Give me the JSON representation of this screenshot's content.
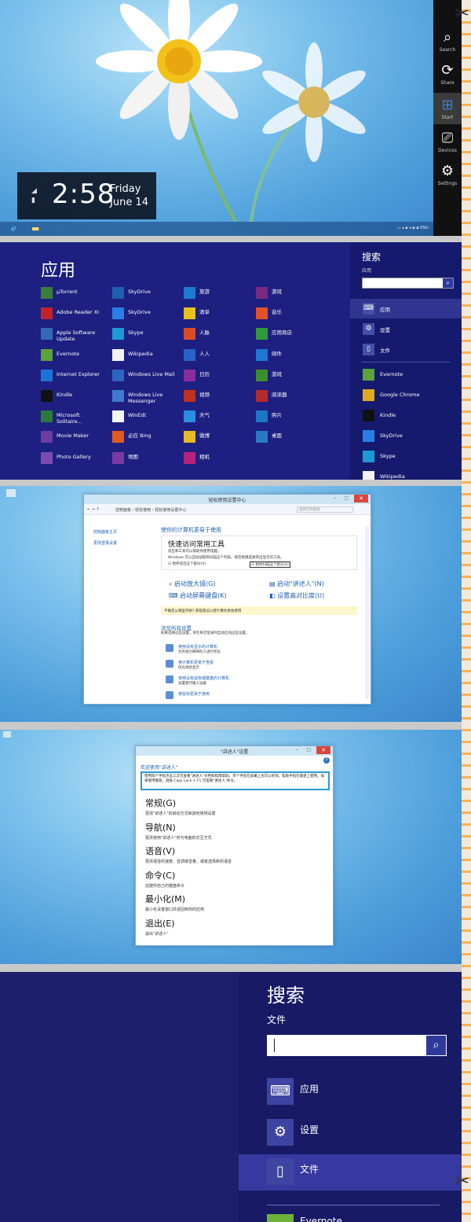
{
  "panel1": {
    "charms": [
      {
        "label": "Search",
        "icon": "search-icon"
      },
      {
        "label": "Share",
        "icon": "share-icon"
      },
      {
        "label": "Start",
        "icon": "windows-icon"
      },
      {
        "label": "Devices",
        "icon": "devices-icon"
      },
      {
        "label": "Settings",
        "icon": "gear-icon"
      }
    ],
    "clock": {
      "time": "2:58",
      "day": "Friday",
      "date": "June 14"
    },
    "tray_text": "ENG"
  },
  "panel2": {
    "title": "应用",
    "apps": [
      {
        "name": "µTorrent",
        "color": "#3a7f3a"
      },
      {
        "name": "SkyDrive",
        "color": "#1f5fb0"
      },
      {
        "name": "旅游",
        "color": "#1d7ad1"
      },
      {
        "name": "游戏",
        "color": "#7a2a82"
      },
      {
        "name": "Adobe Reader XI",
        "color": "#c8202a"
      },
      {
        "name": "SkyDrive",
        "color": "#2a7ee6"
      },
      {
        "name": "清单",
        "color": "#e8c21a"
      },
      {
        "name": "音乐",
        "color": "#e4502a"
      },
      {
        "name": "Apple Software Update",
        "color": "#3569b8"
      },
      {
        "name": "Skype",
        "color": "#1b9ad7"
      },
      {
        "name": "人脉",
        "color": "#d94c28"
      },
      {
        "name": "应用商店",
        "color": "#2f9a3c"
      },
      {
        "name": "Evernote",
        "color": "#5ca33a"
      },
      {
        "name": "Wikipedia",
        "color": "#f2f2f2"
      },
      {
        "name": "人人",
        "color": "#2a62c9"
      },
      {
        "name": "邮件",
        "color": "#1f77d1"
      },
      {
        "name": "Internet Explorer",
        "color": "#1f73d6"
      },
      {
        "name": "Windows Live Mail",
        "color": "#2e64c3"
      },
      {
        "name": "日历",
        "color": "#8a2e9c"
      },
      {
        "name": "游戏",
        "color": "#3b8f2a"
      },
      {
        "name": "Kindle",
        "color": "#111111"
      },
      {
        "name": "Windows Live Messenger",
        "color": "#3f7bd0"
      },
      {
        "name": "视频",
        "color": "#c03020"
      },
      {
        "name": "阅读器",
        "color": "#b52a2a"
      },
      {
        "name": "Microsoft Solitaire...",
        "color": "#2b7a3a"
      },
      {
        "name": "WinEdt",
        "color": "#f4f4f4"
      },
      {
        "name": "天气",
        "color": "#2c8de0"
      },
      {
        "name": "照片",
        "color": "#1d76c7"
      },
      {
        "name": "Movie Maker",
        "color": "#6a3f9f"
      },
      {
        "name": "必应 Bing",
        "color": "#e35a1f"
      },
      {
        "name": "微博",
        "color": "#e6b828"
      },
      {
        "name": "桌面",
        "color": "#2a79c7"
      },
      {
        "name": "Photo Gallery",
        "color": "#7b4bb0"
      },
      {
        "name": "地图",
        "color": "#7a3aa1"
      },
      {
        "name": "相机",
        "color": "#b5227a"
      }
    ],
    "search": {
      "title": "搜索",
      "scope": "应用",
      "categories": [
        {
          "label": "应用",
          "icon": "keyboard-icon"
        },
        {
          "label": "设置",
          "icon": "gear-icon"
        },
        {
          "label": "文件",
          "icon": "file-icon"
        }
      ],
      "results": [
        {
          "label": "Evernote",
          "color": "#5ca33a"
        },
        {
          "label": "Google Chrome",
          "color": "#e0a81e"
        },
        {
          "label": "Kindle",
          "color": "#111111"
        },
        {
          "label": "SkyDrive",
          "color": "#2a7ee6"
        },
        {
          "label": "Skype",
          "color": "#1b9ad7"
        },
        {
          "label": "Wikipedia",
          "color": "#f2f2f2"
        }
      ]
    }
  },
  "panel3": {
    "window_title": "轻松使用设置中心",
    "address": "控制面板 › 轻松使用 › 轻松使用设置中心",
    "search_placeholder": "搜索控制面板",
    "side_links": [
      "控制面板主页",
      "更改登录设置"
    ],
    "heading": "使你的计算机更易于使用",
    "quick_title": "快速访问常用工具",
    "quick_desc1": "说出和工具可以帮助你使用电脑。",
    "quick_desc2": "Windows 可以自动读取和扫描这个列表。按空格键选择突出显示的工具。",
    "check1": "始终读出这个部分(A)",
    "check2": "始终扫描这个部分(S)",
    "tools": [
      "启动放大镜(G)",
      "启动\"讲述人\"(N)",
      "启动屏幕键盘(K)",
      "设置高对比度(U)"
    ],
    "hint": "不确定从哪里开始? 获取建议以使计算机更易使用",
    "browse_title": "浏览所有设置",
    "browse_desc": "如果选择这些设置，则在每次登录时自动启动这些设置。",
    "items": [
      {
        "t": "使用没有显示的计算机",
        "d": "为有视力障碍的人进行优化"
      },
      {
        "t": "使计算机更易于查看",
        "d": "优化视觉显示"
      },
      {
        "t": "使用没有鼠标或键盘的计算机",
        "d": "设置替代输入设备"
      },
      {
        "t": "使鼠标更易于使用",
        "d": ""
      }
    ]
  },
  "panel4": {
    "window_title": "\"讲述人\"设置",
    "welcome": "欢迎使用\"讲述人\"",
    "desc": "使用四个手指点击三次可查看\"讲述人\"文档和指南帮助。单个手指在屏幕上也可以听到。帮助手指在键盘上使用。如果使用键盘，则按 Caps Lock + F1 可查看\"讲述人\"命令。",
    "sections": [
      {
        "k": "常规(G)",
        "d": "更改\"讲述人\"的启动方式和其他常规设置"
      },
      {
        "k": "导航(N)",
        "d": "更改使用\"讲述人\"时与电脑的交互方式"
      },
      {
        "k": "语音(V)",
        "d": "更改语音的速度、音调或音量，或者选择新的语音"
      },
      {
        "k": "命令(C)",
        "d": "创建你自己的键盘命令"
      },
      {
        "k": "最小化(M)",
        "d": "最小化设置窗口并返回到你的应用"
      },
      {
        "k": "退出(E)",
        "d": "退出\"讲述人\""
      }
    ]
  },
  "panel5": {
    "title": "搜索",
    "scope": "文件",
    "categories": [
      {
        "label": "应用",
        "icon": "keyboard-icon"
      },
      {
        "label": "设置",
        "icon": "gear-icon"
      },
      {
        "label": "文件",
        "icon": "file-icon"
      }
    ],
    "result": "Evernote"
  },
  "colors": {
    "start_bg": "#1d2080",
    "search_pane": "#161a6e",
    "accent_blue": "#2d3a9c",
    "close_red": "#d9453c"
  }
}
